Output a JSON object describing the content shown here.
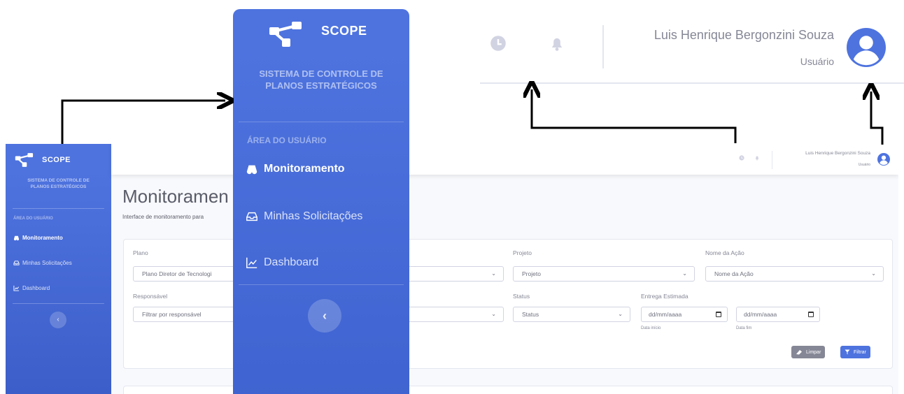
{
  "brand": {
    "name": "SCOPE",
    "subtitle_line1": "SISTEMA DE CONTROLE DE",
    "subtitle_line2": "PLANOS ESTRATÉGICOS"
  },
  "sidebar": {
    "section_heading": "ÁREA DO USUÁRIO",
    "items": [
      {
        "label": "Monitoramento",
        "icon": "binoculars-icon",
        "active": true
      },
      {
        "label": "Minhas Solicitações",
        "icon": "inbox-icon",
        "active": false
      },
      {
        "label": "Dashboard",
        "icon": "chart-area-icon",
        "active": false
      }
    ],
    "toggle_glyph": "‹"
  },
  "topbar": {
    "user_name": "Luis Henrique Bergonzini Souza",
    "user_role": "Usuário",
    "icons": [
      "clock-icon",
      "bell-icon",
      "user-circle-icon"
    ]
  },
  "page": {
    "title": "Monitoramen",
    "description": "Interface de monitoramento para"
  },
  "filters": {
    "plano_label": "Plano",
    "plano_value": "Plano Diretor de Tecnologi",
    "projeto_label": "Projeto",
    "projeto_value": "Projeto",
    "acao_label": "Nome da Ação",
    "acao_value": "Nome da Ação",
    "responsavel_label": "Responsável",
    "responsavel_placeholder": "Filtrar por responsável",
    "status_label": "Status",
    "status_value": "Status",
    "entrega_label": "Entrega Estimada",
    "date_placeholder": "dd/mm/aaaa",
    "data_inicio": "Data início",
    "data_fim": "Data fim",
    "clear_button": "Limpar",
    "filter_button": "Filtrar"
  },
  "colors": {
    "primary": "#4e73df",
    "sidebar_dark": "#3c5ec9",
    "muted": "#858796",
    "border": "#d1d3e2"
  }
}
